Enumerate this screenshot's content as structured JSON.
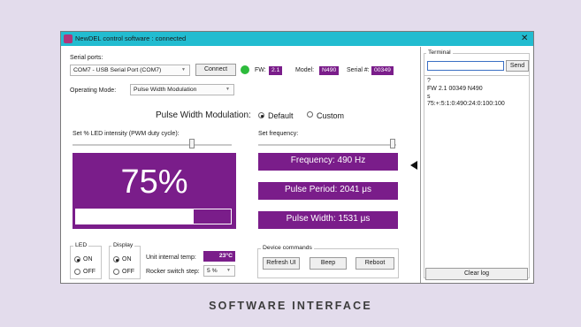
{
  "window": {
    "title": "NewDEL control software : connected",
    "close_icon": "✕"
  },
  "serial": {
    "label": "Serial ports:",
    "port": "COM7 - USB Serial Port (COM7)",
    "connect": "Connect",
    "fw_label": "FW:",
    "fw": "2.1",
    "model_label": "Model:",
    "model": "N490",
    "serial_label": "Serial #:",
    "serial": "00349"
  },
  "mode": {
    "label": "Operating Mode:",
    "value": "Pulse Width Modulation"
  },
  "pwm": {
    "heading": "Pulse Width Modulation:",
    "opt_default": "Default",
    "opt_custom": "Custom",
    "intensity_label": "Set % LED intensity (PWM duty cycle):",
    "frequency_label": "Set frequency:",
    "intensity_value": "75%",
    "intensity_fraction": 0.75
  },
  "readouts": {
    "frequency": "Frequency: 490 Hz",
    "period": "Pulse Period: 2041 μs",
    "width": "Pulse Width: 1531 μs"
  },
  "led": {
    "label": "LED",
    "on": "ON",
    "off": "OFF"
  },
  "display": {
    "label": "Display",
    "on": "ON",
    "off": "OFF"
  },
  "temp": {
    "label": "Unit internal temp:",
    "value": "23°C"
  },
  "rocker": {
    "label": "Rocker switch step:",
    "value": "5 %"
  },
  "commands": {
    "label": "Device commands",
    "refresh": "Refresh UI",
    "beep": "Beep",
    "reboot": "Reboot"
  },
  "terminal": {
    "label": "Terminal",
    "send": "Send",
    "lines": [
      "?",
      "FW 2.1 00349 N490",
      "s",
      "75:+:5:1:0:490:24:0:100:100"
    ],
    "clear": "Clear log"
  },
  "caption": "SOFTWARE INTERFACE",
  "colors": {
    "accent": "#7a1d8a",
    "titlebar": "#22bcd0",
    "status": "#2dbb3c",
    "background": "#e3dcec"
  }
}
